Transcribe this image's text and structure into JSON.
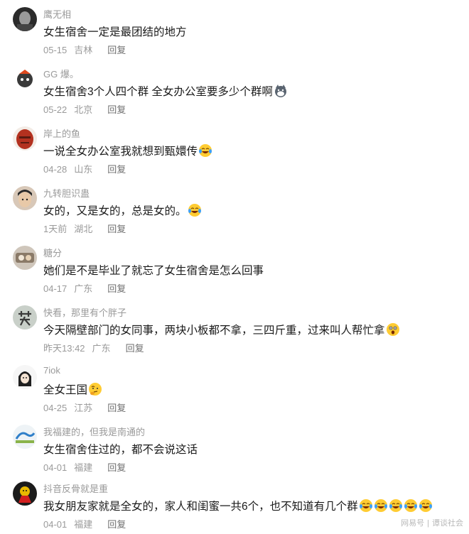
{
  "comments": [
    {
      "user": "鹰无相",
      "text": "女生宿舍一定是最团结的地方",
      "date": "05-15",
      "location": "吉林",
      "reply": "回复",
      "emojis": []
    },
    {
      "user": "GG 爆。",
      "text": "女生宿舍3个人四个群  全女办公室要多少个群啊",
      "date": "05-22",
      "location": "北京",
      "reply": "回复",
      "emojis": [
        "wolf-face-emoji"
      ]
    },
    {
      "user": "岸上的鱼",
      "text": "一说全女办公室我就想到甄嬛传",
      "date": "04-28",
      "location": "山东",
      "reply": "回复",
      "emojis": [
        "laugh-cry-emoji"
      ]
    },
    {
      "user": "九转胆识蛊",
      "text": "女的，又是女的，总是女的。",
      "date": "1天前",
      "location": "湖北",
      "reply": "回复",
      "emojis": [
        "laugh-cry-emoji"
      ]
    },
    {
      "user": "糖分",
      "text": "她们是不是毕业了就忘了女生宿舍是怎么回事",
      "date": "04-17",
      "location": "广东",
      "reply": "回复",
      "emojis": []
    },
    {
      "user": "快看，那里有个胖子",
      "text": "今天隔壁部门的女同事，两块小板都不拿，三四斤重，过来叫人帮忙拿",
      "date": "昨天13:42",
      "location": "广东",
      "reply": "回复",
      "emojis": [
        "surprised-emoji"
      ]
    },
    {
      "user": "7iok",
      "text": "全女王国",
      "date": "04-25",
      "location": "江苏",
      "reply": "回复",
      "emojis": [
        "thinking-emoji"
      ]
    },
    {
      "user": "我福建的，但我是南通的",
      "text": "女生宿舍住过的，都不会说这话",
      "date": "04-01",
      "location": "福建",
      "reply": "回复",
      "emojis": []
    },
    {
      "user": "抖音反骨就是重",
      "text": "我女朋友家就是全女的，家人和闺蜜一共6个，也不知道有几个群",
      "date": "04-01",
      "location": "福建",
      "reply": "回复",
      "emojis": [
        "laugh-cry-emoji",
        "laugh-cry-emoji",
        "laugh-cry-emoji",
        "laugh-cry-emoji",
        "laugh-cry-emoji"
      ]
    }
  ],
  "watermark": {
    "source": "网易号",
    "author": "谭谈社会"
  },
  "colors": {
    "meta": "#9a9a9a",
    "text": "#1a1a1a",
    "reply": "#6f6f6f"
  }
}
